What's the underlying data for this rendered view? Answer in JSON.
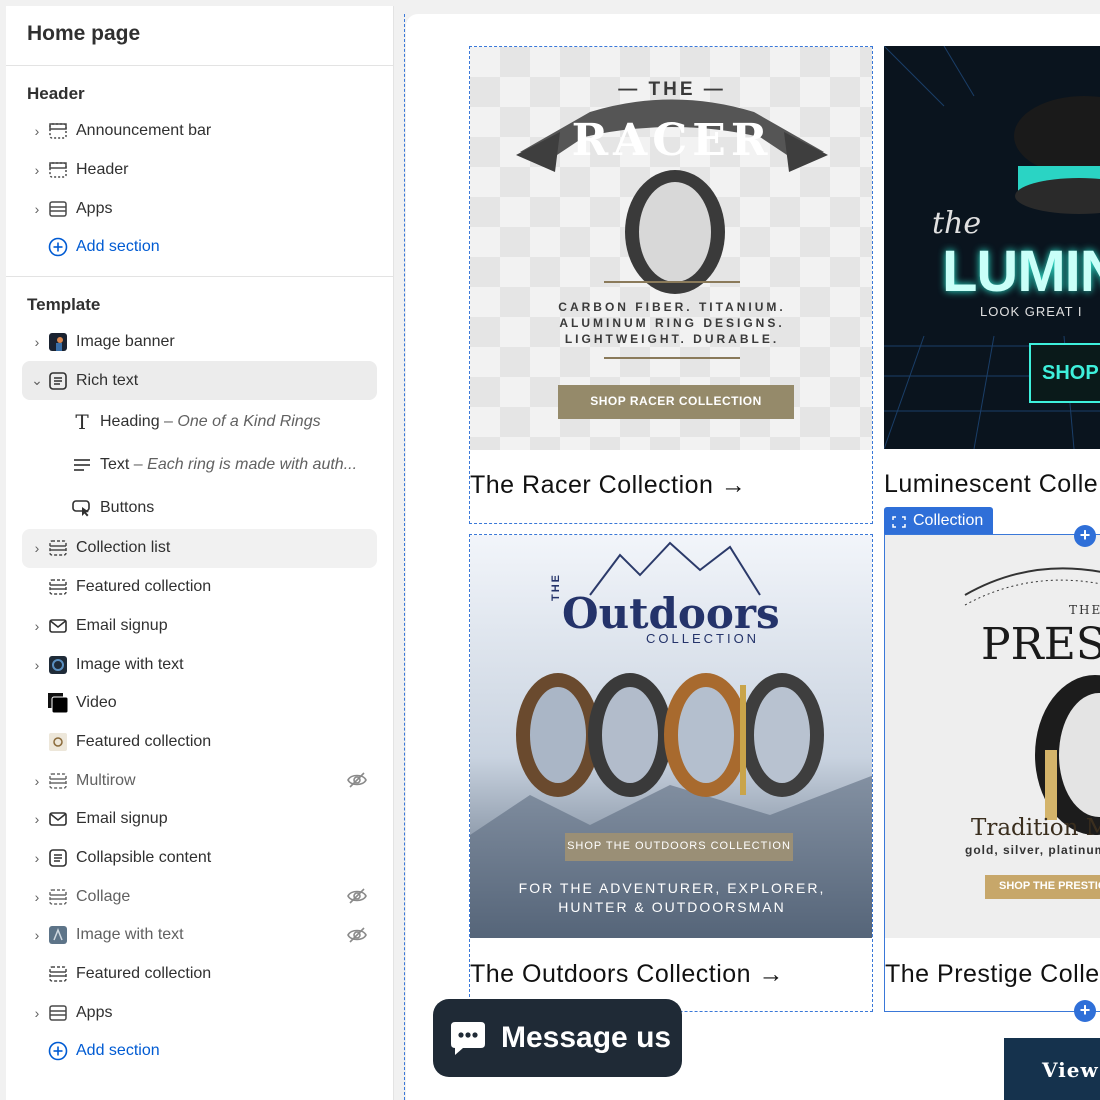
{
  "sidebar": {
    "title": "Home page",
    "header_group": {
      "title": "Header",
      "items": [
        {
          "label": "Announcement bar"
        },
        {
          "label": "Header"
        },
        {
          "label": "Apps"
        }
      ],
      "add_section": "Add section"
    },
    "template_group": {
      "title": "Template",
      "items": [
        {
          "label": "Image banner"
        },
        {
          "label": "Rich text"
        },
        {
          "label": "Collection list"
        },
        {
          "label": "Featured collection"
        },
        {
          "label": "Email signup"
        },
        {
          "label": "Image with text"
        },
        {
          "label": "Video"
        },
        {
          "label": "Featured collection"
        },
        {
          "label": "Multirow"
        },
        {
          "label": "Email signup"
        },
        {
          "label": "Collapsible content"
        },
        {
          "label": "Collage"
        },
        {
          "label": "Image with text"
        },
        {
          "label": "Featured collection"
        },
        {
          "label": "Apps"
        }
      ],
      "rich_text_blocks": [
        {
          "label": "Heading",
          "detail": "One of a Kind Rings"
        },
        {
          "label": "Text",
          "detail": "Each ring is made with auth..."
        },
        {
          "label": "Buttons",
          "detail": ""
        }
      ],
      "add_section": "Add section",
      "separator": " – "
    }
  },
  "preview": {
    "collections": [
      {
        "caption": "The Racer Collection →",
        "banner": {
          "the": "— THE —",
          "name": "RACER",
          "tagline": [
            "CARBON FIBER. TITANIUM.",
            "ALUMINUM RING DESIGNS.",
            "LIGHTWEIGHT. DURABLE."
          ],
          "button": "SHOP RACER COLLECTION"
        }
      },
      {
        "caption": "Luminescent Colle",
        "banner": {
          "the": "the",
          "name": "LUMINE",
          "tagline": [
            "LOOK GREAT I"
          ],
          "button": "SHOP N"
        }
      },
      {
        "caption": "The Outdoors Collection →",
        "banner": {
          "the": "THE",
          "name": "Outdoors",
          "sub": "COLLECTION",
          "button": "SHOP THE OUTDOORS COLLECTION",
          "tagline": [
            "FOR THE ADVENTURER, EXPLORER,",
            "HUNTER & OUTDOORSMAN"
          ]
        }
      },
      {
        "caption": "The Prestige Colle",
        "banner": {
          "the": "THE",
          "name": "PREST",
          "tagline": [
            "Tradition Me",
            "gold, silver, platinum"
          ],
          "button": "SHOP THE PRESTIG"
        }
      }
    ],
    "selection_tag": "Collection",
    "message_button": "Message us",
    "view_button": "View"
  }
}
